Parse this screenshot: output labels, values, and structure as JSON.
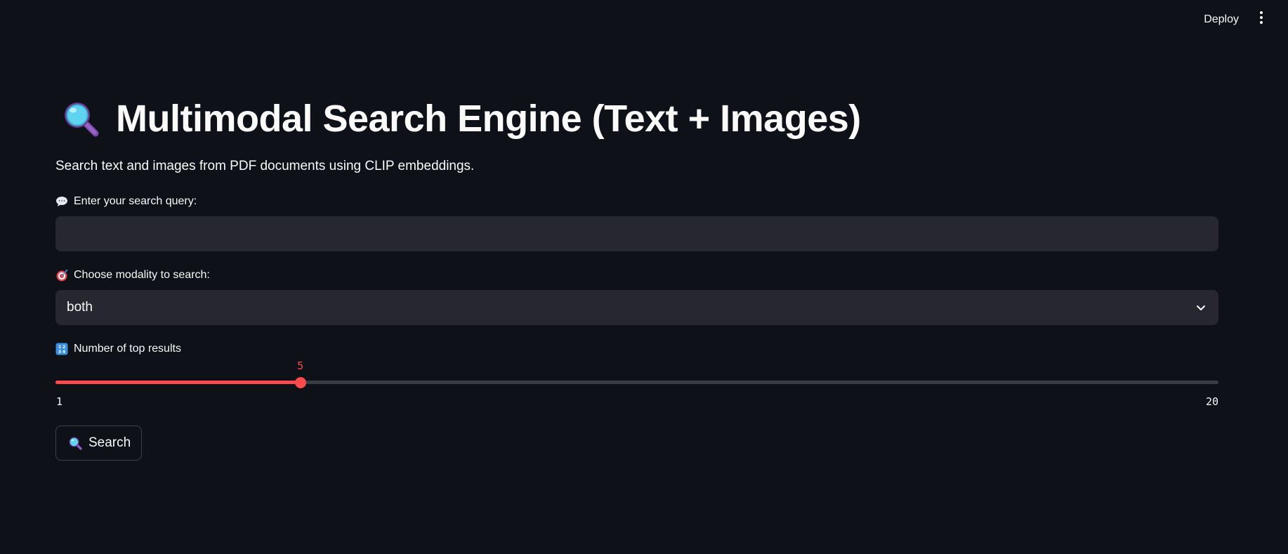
{
  "header": {
    "deploy_label": "Deploy",
    "menu_icon": "vertical-dots-icon"
  },
  "main": {
    "title": "Multimodal Search Engine (Text + Images)",
    "title_icon": "magnifying-glass-icon",
    "subtitle": "Search text and images from PDF documents using CLIP embeddings."
  },
  "query": {
    "label": "Enter your search query:",
    "label_icon": "speech-bubble-icon",
    "value": "",
    "placeholder": ""
  },
  "modality": {
    "label": "Choose modality to search:",
    "label_icon": "bullseye-icon",
    "selected": "both"
  },
  "top_results": {
    "label": "Number of top results",
    "label_icon": "numbers-icon",
    "value": 5,
    "value_label": "5",
    "min": 1,
    "max": 20,
    "min_label": "1",
    "max_label": "20"
  },
  "search_button": {
    "label": "Search",
    "icon": "magnifying-glass-icon"
  },
  "colors": {
    "background": "#0e1117",
    "input_bg": "#262730",
    "accent": "#ff4b4b",
    "text": "#fafafa"
  }
}
